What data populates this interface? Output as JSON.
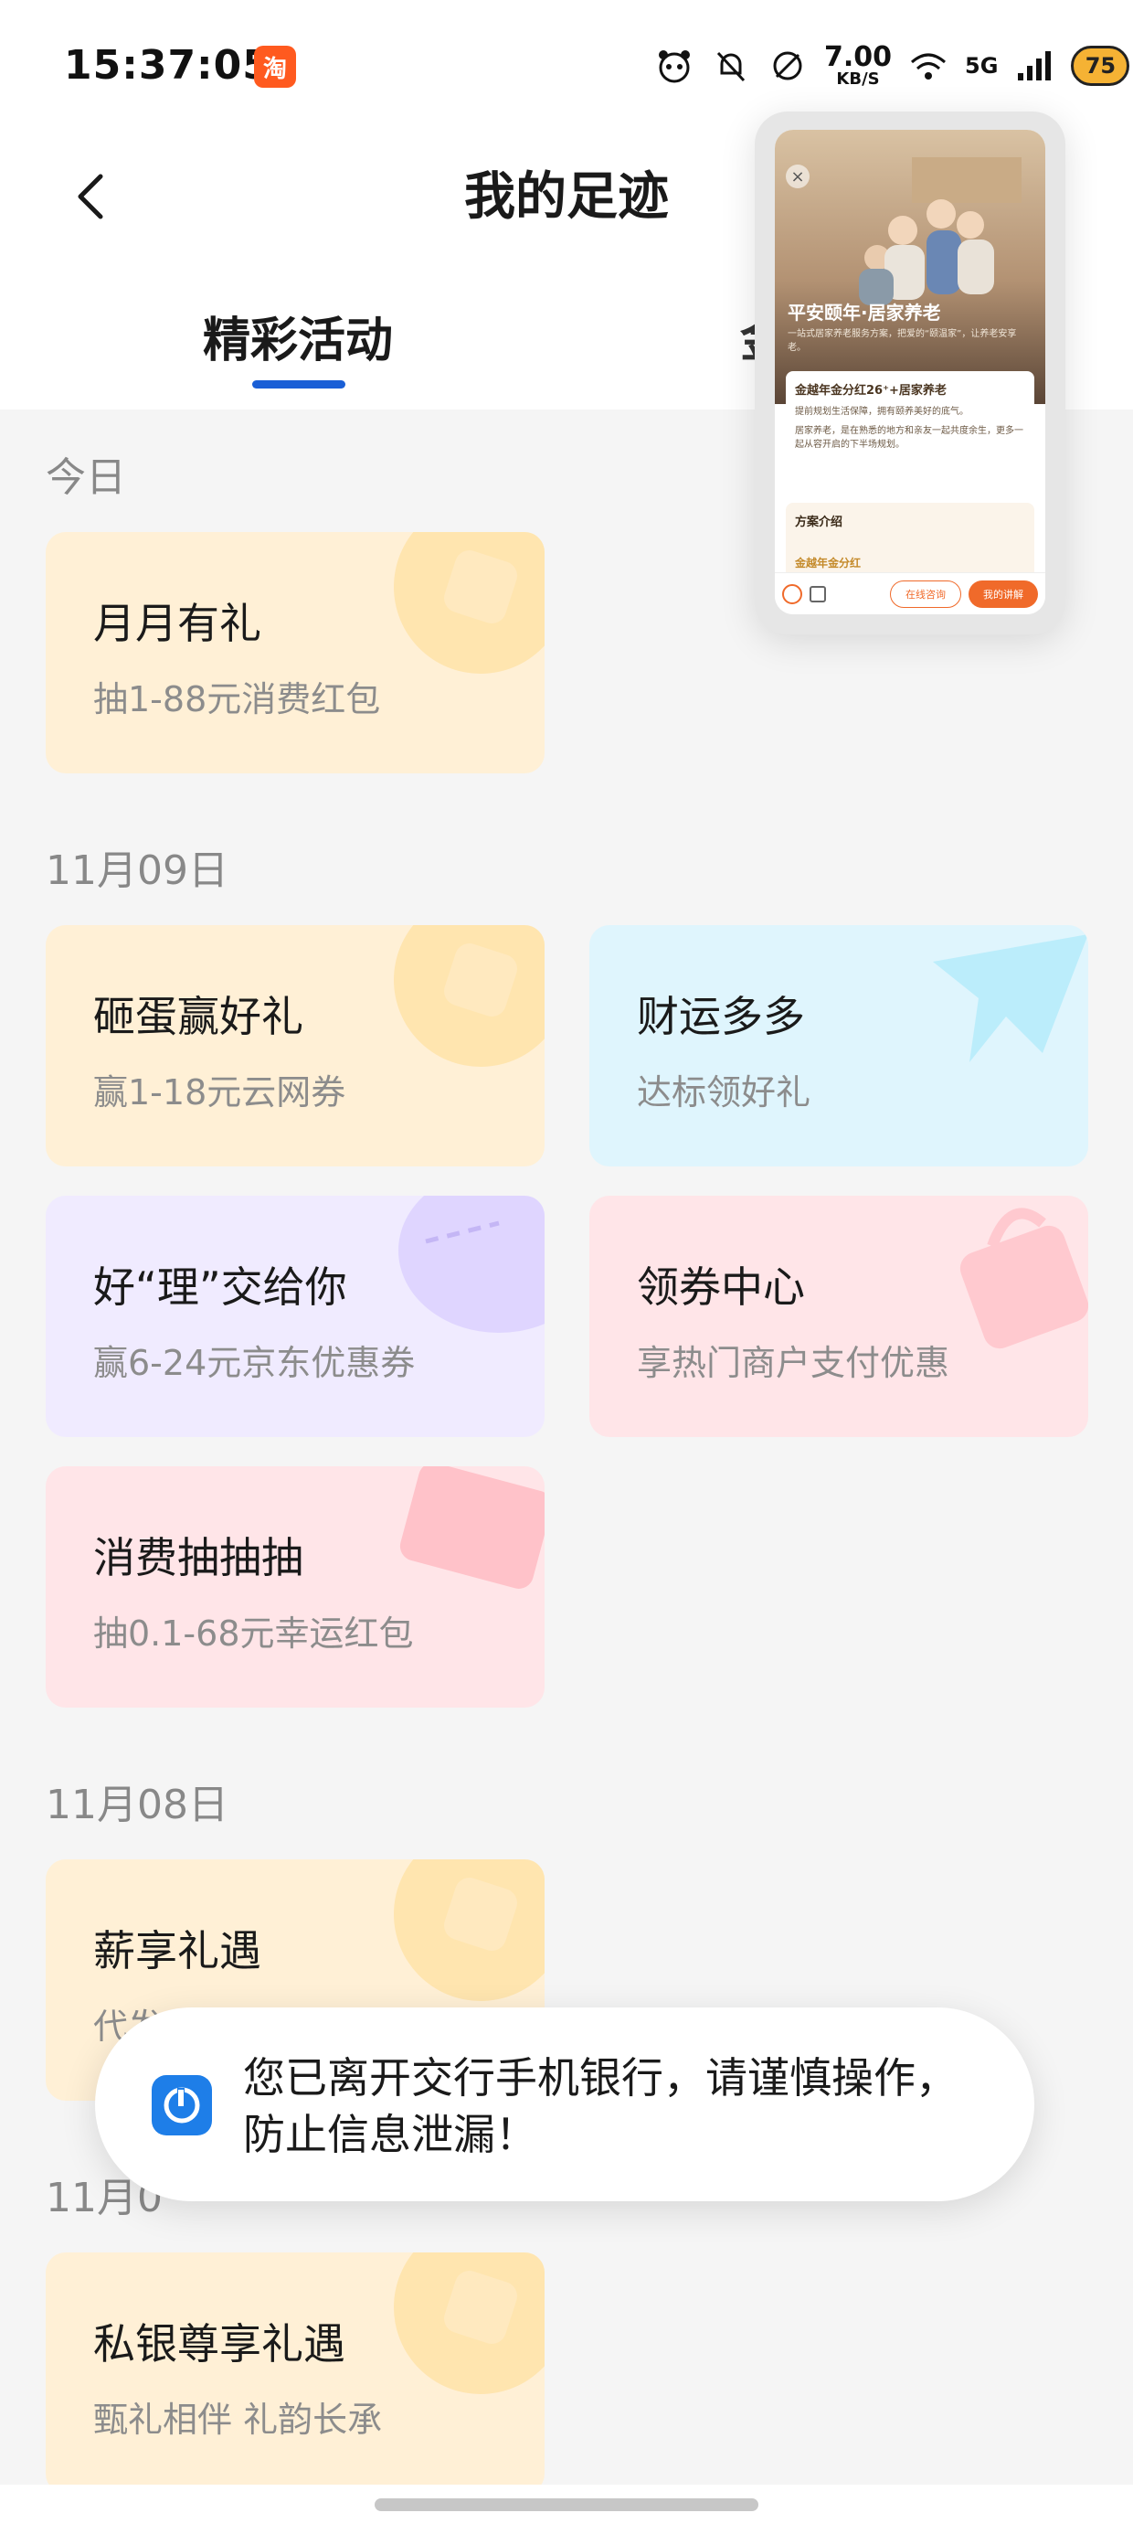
{
  "status_bar": {
    "time": "15:37:05",
    "app_badge": "淘",
    "net_speed_value": "7.00",
    "net_speed_unit": "KB/S",
    "net_type": "5G",
    "battery": "75"
  },
  "header": {
    "title": "我的足迹",
    "back_icon": "chevron-left-icon"
  },
  "tabs": [
    {
      "label": "精彩活动",
      "active": true
    },
    {
      "label": "金",
      "active": false
    }
  ],
  "groups": [
    {
      "date": "今日",
      "cards": [
        {
          "title": "月月有礼",
          "subtitle": "抽1-88元消费红包",
          "theme": "orange"
        }
      ]
    },
    {
      "date": "11月09日",
      "cards": [
        {
          "title": "砸蛋赢好礼",
          "subtitle": "赢1-18元云网券",
          "theme": "orange"
        },
        {
          "title": "财运多多",
          "subtitle": "达标领好礼",
          "theme": "blue"
        },
        {
          "title": "好“理”交给你",
          "subtitle": "赢6-24元京东优惠券",
          "theme": "purple"
        },
        {
          "title": "领券中心",
          "subtitle": "享热门商户支付优惠",
          "theme": "pink"
        },
        {
          "title": "消费抽抽抽",
          "subtitle": "抽0.1-68元幸运红包",
          "theme": "pink"
        }
      ]
    },
    {
      "date": "11月08日",
      "cards": [
        {
          "title": "薪享礼遇",
          "subtitle": "代发",
          "theme": "orange"
        }
      ]
    },
    {
      "date": "11月0",
      "cards": [
        {
          "title": "私银尊享礼遇",
          "subtitle": "甄礼相伴 礼韵长承",
          "theme": "orange"
        }
      ]
    }
  ],
  "pip": {
    "caption": "平安颐年·居家养老",
    "caption_sub": "一站式居家养老服务方案，把爱的“颐温家”，让养老安享老。",
    "panel_title": "金越年金分红26⁺+居家养老",
    "panel_lines": [
      "提前规划生活保障，拥有颐养美好的底气。",
      "居家养老，是在熟悉的地方和亲友一起共度余生，更多一起从容开启的下半场规划。"
    ],
    "section_title": "方案介绍",
    "section_sub": "金越年金分红",
    "btn_consult": "在线咨询",
    "btn_plan": "我的讲解"
  },
  "toast": {
    "text": "您已离开交行手机银行，请谨慎操作，防止信息泄漏！",
    "icon": "bocom-logo-icon"
  }
}
